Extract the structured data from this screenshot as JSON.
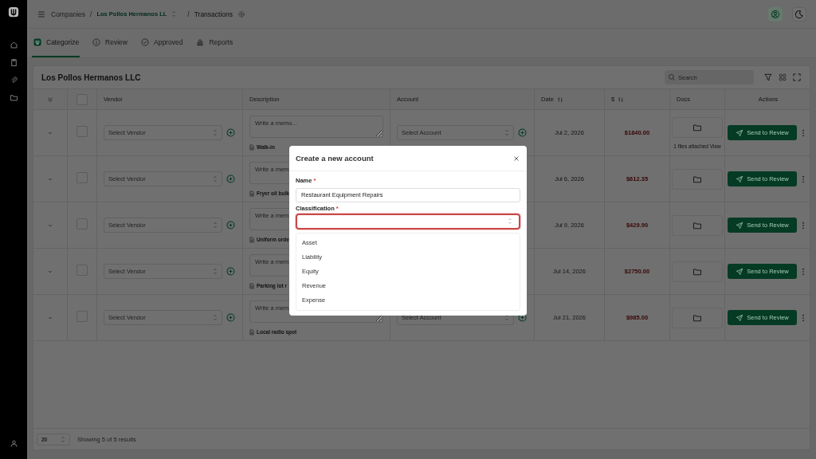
{
  "breadcrumb": {
    "root": "Companies",
    "separator": "/",
    "company": "Los Pollos Hermanos LL",
    "page": "Transactions"
  },
  "tabs": [
    {
      "label": "Categorize",
      "selected": true
    },
    {
      "label": "Review",
      "selected": false
    },
    {
      "label": "Approved",
      "selected": false
    },
    {
      "label": "Reports",
      "selected": false
    }
  ],
  "card": {
    "title": "Los Pollos Hermanos LLC",
    "search": {
      "placeholder": "Search"
    }
  },
  "table": {
    "all_checked": false,
    "columns": [
      {
        "label": "Vendor",
        "sortable": false
      },
      {
        "label": "Description",
        "sortable": false
      },
      {
        "label": "Account",
        "sortable": false
      },
      {
        "label": "Date",
        "sortable": true
      },
      {
        "label": "$",
        "sortable": true
      },
      {
        "label": "Docs",
        "sortable": false
      },
      {
        "label": "Actions",
        "sortable": false
      }
    ],
    "rows": [
      {
        "checked": false,
        "vendor": "Select Vendor",
        "memo": {
          "placeholder": "Write a memo..."
        },
        "note": "Walk-in",
        "account": "Select Account",
        "date": "Jul 2, 2026",
        "amount": "$1840.00",
        "docs": "1 files attached View",
        "action": "Send to Review"
      },
      {
        "checked": false,
        "vendor": "Select Vendor",
        "memo": {
          "placeholder": "Write a mem"
        },
        "note": "Fryer oil bulk",
        "date": "Jul 6, 2026",
        "amount": "$612.35",
        "action": "Send to Review"
      },
      {
        "checked": false,
        "vendor": "Select Vendor",
        "memo": {
          "placeholder": "Write a mem"
        },
        "note": "Uniform orde",
        "date": "Jul 9, 2026",
        "amount": "$429.90",
        "action": "Send to Review"
      },
      {
        "checked": false,
        "vendor": "Select Vendor",
        "memo": {
          "placeholder": "Write a mem"
        },
        "note": "Parking lot r",
        "date": "Jul 14, 2026",
        "amount": "$2750.00",
        "action": "Send to Review"
      },
      {
        "checked": false,
        "vendor": "Select Vendor",
        "memo": {
          "placeholder": "Write a mem"
        },
        "note": "Local radio spot",
        "account": "Select Account",
        "date": "Jul 21, 2026",
        "amount": "$985.00",
        "action": "Send to Review"
      }
    ]
  },
  "footer": {
    "page_size": "20",
    "summary": "Showing 5 of 5 results"
  },
  "modal": {
    "title": "Create a new account",
    "fields": [
      {
        "label": "Name",
        "required_mark": "*",
        "value": "Restaurant Equipment Repairs",
        "kind": "text"
      },
      {
        "label": "Classification",
        "required_mark": "*",
        "kind": "select",
        "invalid": true,
        "options": [
          "Asset",
          "Liability",
          "Equity",
          "Revenue",
          "Expense"
        ]
      }
    ]
  }
}
